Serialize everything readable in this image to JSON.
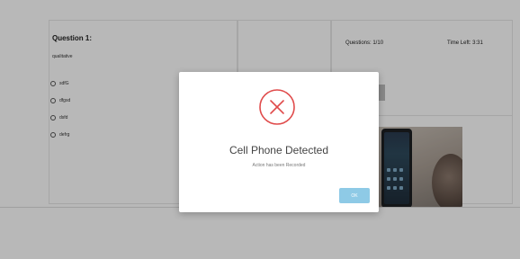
{
  "question_panel": {
    "title": "Question 1:",
    "text": "qualitative",
    "options": [
      {
        "label": "sdfG"
      },
      {
        "label": "dfgsd"
      },
      {
        "label": "dsfd"
      },
      {
        "label": "defrg"
      }
    ]
  },
  "status_bar": {
    "questions": "Questions: 1/10",
    "time_left": "Time Left: 3:31"
  },
  "modal": {
    "icon": "error-x-circle-icon",
    "title": "Cell Phone Detected",
    "message": "Action has been Recorded",
    "ok_label": "OK"
  },
  "colors": {
    "error": "#e04b4b",
    "ok_button": "#8ecae6"
  }
}
